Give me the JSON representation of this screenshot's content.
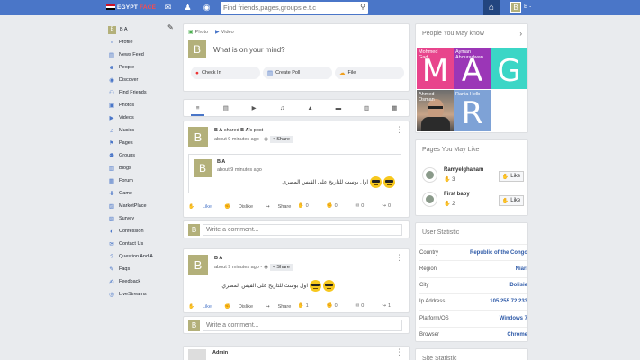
{
  "topbar": {
    "logo_main": "EGYPT",
    "logo_accent": "FACE",
    "search_placeholder": "Find friends,pages,groups e.t.c",
    "user_initial": "B",
    "user_label": "B -",
    "flag_colors": [
      "#ce1126",
      "#ffffff",
      "#000000"
    ]
  },
  "sidebar": {
    "user": {
      "initial": "B",
      "name": "B A"
    },
    "items": [
      {
        "label": "Profile",
        "icon": "person-icon",
        "glyph": "▫"
      },
      {
        "label": "News Feed",
        "icon": "newspaper-icon",
        "glyph": "▤"
      },
      {
        "label": "People",
        "icon": "people-icon",
        "glyph": "☻"
      },
      {
        "label": "Discover",
        "icon": "compass-icon",
        "glyph": "◉"
      },
      {
        "label": "Find Friends",
        "icon": "find-friends-icon",
        "glyph": "⚇"
      },
      {
        "label": "Photos",
        "icon": "photo-icon",
        "glyph": "▣"
      },
      {
        "label": "Videos",
        "icon": "video-icon",
        "glyph": "▶"
      },
      {
        "label": "Musics",
        "icon": "music-icon",
        "glyph": "♫"
      },
      {
        "label": "Pages",
        "icon": "flag-icon",
        "glyph": "⚑"
      },
      {
        "label": "Groups",
        "icon": "groups-icon",
        "glyph": "⚉"
      },
      {
        "label": "Blogs",
        "icon": "blog-icon",
        "glyph": "▥"
      },
      {
        "label": "Forum",
        "icon": "forum-icon",
        "glyph": "▦"
      },
      {
        "label": "Game",
        "icon": "game-icon",
        "glyph": "✚"
      },
      {
        "label": "MarketPlace",
        "icon": "market-icon",
        "glyph": "▨"
      },
      {
        "label": "Survey",
        "icon": "survey-icon",
        "glyph": "▧"
      },
      {
        "label": "Confession",
        "icon": "confession-icon",
        "glyph": "◐"
      },
      {
        "label": "Contact Us",
        "icon": "mail-icon",
        "glyph": "✉"
      },
      {
        "label": "Question And A...",
        "icon": "question-icon",
        "glyph": "?"
      },
      {
        "label": "Faqs",
        "icon": "faq-icon",
        "glyph": "✎"
      },
      {
        "label": "Feedback",
        "icon": "feedback-icon",
        "glyph": "✍"
      },
      {
        "label": "LiveStreams",
        "icon": "livestream-icon",
        "glyph": "◎"
      }
    ]
  },
  "composer": {
    "tab_photo": "Photo",
    "tab_video": "Video",
    "avatar_initial": "B",
    "prompt": "What is on your mind?",
    "actions": [
      "Check In",
      "Create Poll",
      "File"
    ]
  },
  "filter_tabs": [
    "≡",
    "▤",
    "▶",
    "♫",
    "▲",
    "▬",
    "▥",
    "▦"
  ],
  "posts": [
    {
      "initial": "B",
      "author": "B A",
      "verb": "shared",
      "target": "B A",
      "suffix": "'s post",
      "time": "about 9 minutes ago -",
      "share": "Share",
      "inner": {
        "initial": "B",
        "author": "B A",
        "time": "about 9 minutes ago",
        "text": "اول بوست للتاريخ على الفيس المصري"
      },
      "like": "Like",
      "dislike": "Dislike",
      "share_action": "Share",
      "counts": [
        "0",
        "0",
        "0",
        "0"
      ]
    },
    {
      "initial": "B",
      "author": "B A",
      "time": "about 9 minutes ago -",
      "share": "Share",
      "text": "اول بوست للتاريخ على الفيس المصري",
      "like": "Like",
      "dislike": "Dislike",
      "share_action": "Share",
      "counts": [
        "1",
        "0",
        "0",
        "1"
      ]
    }
  ],
  "comment": {
    "initial": "B",
    "placeholder": "Write a comment..."
  },
  "post3": {
    "author": "Admin"
  },
  "people_you_may_know": {
    "title": "People You May know",
    "tiles": [
      {
        "name": "Mohmed\nGad",
        "letter": "M",
        "color": "#e8448c"
      },
      {
        "name": "Ayman\nAbouradwan",
        "letter": "A",
        "color": "#9b36b7"
      },
      {
        "name": "",
        "letter": "G",
        "color": "#3bd6c6"
      },
      {
        "name": "Ahmed\nOsman",
        "letter": "",
        "color": ""
      },
      {
        "name": "Rania Helb",
        "letter": "R",
        "color": "#7ea2d6"
      }
    ]
  },
  "pages_you_may_like": {
    "title": "Pages You May Like",
    "pages": [
      {
        "name": "Ramyelghanam",
        "likes": "3",
        "button": "Like"
      },
      {
        "name": "First baby",
        "likes": "2",
        "button": "Like"
      }
    ]
  },
  "user_statistic": {
    "title": "User Statistic",
    "rows": [
      {
        "k": "Country",
        "v": "Republic of the Congo"
      },
      {
        "k": "Region",
        "v": "Niari"
      },
      {
        "k": "City",
        "v": "Dolisie"
      },
      {
        "k": "Ip Address",
        "v": "105.255.72.233"
      },
      {
        "k": "Platform/OS",
        "v": "Windows 7"
      },
      {
        "k": "Browser",
        "v": "Chrome"
      }
    ]
  },
  "site_statistic": {
    "title": "Site Statistic"
  }
}
